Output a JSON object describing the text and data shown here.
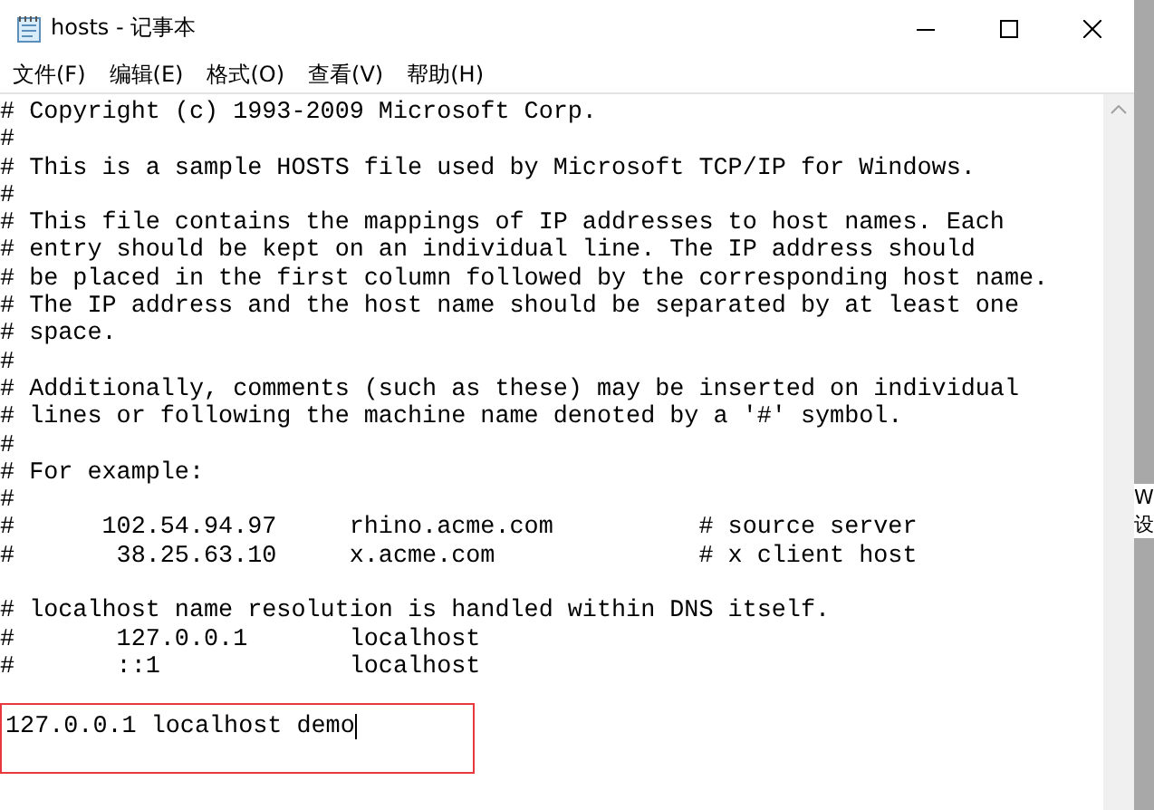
{
  "window": {
    "title": "hosts - 记事本"
  },
  "menu": [
    "文件(F)",
    "编辑(E)",
    "格式(O)",
    "查看(V)",
    "帮助(H)"
  ],
  "editor": {
    "blocks": [
      [
        "# Copyright (c) 1993-2009 Microsoft Corp.",
        "#",
        "# This is a sample HOSTS file used by Microsoft TCP/IP for Windows.",
        "#",
        "# This file contains the mappings of IP addresses to host names. Each",
        "# entry should be kept on an individual line. The IP address should",
        "# be placed in the first column followed by the corresponding host name.",
        "# The IP address and the host name should be separated by at least one",
        "# space.",
        "#",
        "# Additionally, comments (such as these) may be inserted on individual",
        "# lines or following the machine name denoted by a '#' symbol.",
        "#",
        "# For example:",
        "#",
        "#      102.54.94.97     rhino.acme.com          # source server",
        "#       38.25.63.10     x.acme.com              # x client host"
      ],
      [
        "# localhost name resolution is handled within DNS itself.",
        "#       127.0.0.1       localhost",
        "#       ::1             localhost"
      ]
    ],
    "highlighted_entry": {
      "text": "127.0.0.1 localhost demo",
      "caret": true
    }
  },
  "background_window": {
    "texts": [
      "W",
      "设"
    ]
  }
}
